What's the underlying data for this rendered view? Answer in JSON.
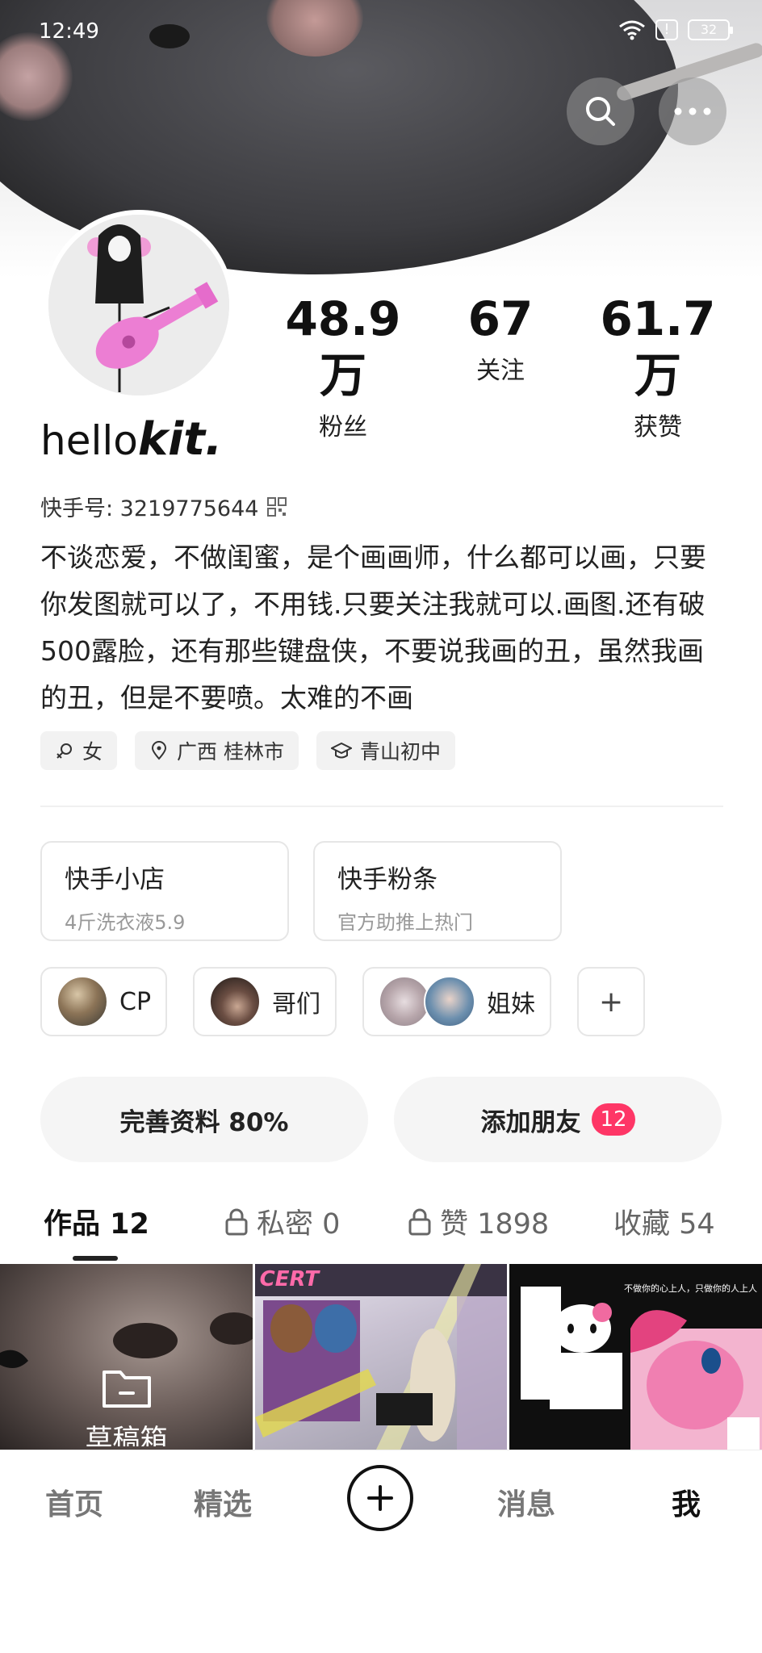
{
  "status_bar": {
    "time": "12:49",
    "alert": "!",
    "battery": "32"
  },
  "profile": {
    "nickname_part1": "hello",
    "nickname_part2": "kit.",
    "kuaishou_id": "快手号: 3219775644",
    "bio": "不谈恋爱，不做闺蜜，是个画画师，什么都可以画，只要你发图就可以了，不用钱.只要关注我就可以.画图.还有破500露脸，还有那些键盘侠，不要说我画的丑，虽然我画的丑，但是不要喷。太难的不画"
  },
  "stats": [
    {
      "value": "48.9万",
      "label": "粉丝"
    },
    {
      "value": "67",
      "label": "关注"
    },
    {
      "value": "61.7万",
      "label": "获赞"
    }
  ],
  "tags": [
    {
      "icon": "female-icon",
      "text": "女"
    },
    {
      "icon": "location-pin-icon",
      "text": "广西 桂林市"
    },
    {
      "icon": "graduation-cap-icon",
      "text": "青山初中"
    }
  ],
  "cards": [
    {
      "title": "快手小店",
      "subtitle": "4斤洗衣液5.9"
    },
    {
      "title": "快手粉条",
      "subtitle": "官方助推上热门"
    }
  ],
  "relations": [
    {
      "label": "CP"
    },
    {
      "label": "哥们"
    },
    {
      "label": "姐妹"
    },
    {
      "label": "+"
    }
  ],
  "actions": {
    "complete_profile": "完善资料 80%",
    "add_friends": "添加朋友",
    "add_friends_badge": "12"
  },
  "tabs": [
    {
      "label": "作品 12"
    },
    {
      "label": "私密 0"
    },
    {
      "label": "赞 1898"
    },
    {
      "label": "收藏 54"
    }
  ],
  "grid": {
    "drafts_label": "草稿箱",
    "thumb2_text": "CERT",
    "thumb3_text": "不做你的心上人，只做你的人上人"
  },
  "bottom_nav": {
    "home": "首页",
    "featured": "精选",
    "messages": "消息",
    "me": "我"
  },
  "colors": {
    "badge": "#fe3666",
    "text": "#222222",
    "muted": "#999999"
  }
}
